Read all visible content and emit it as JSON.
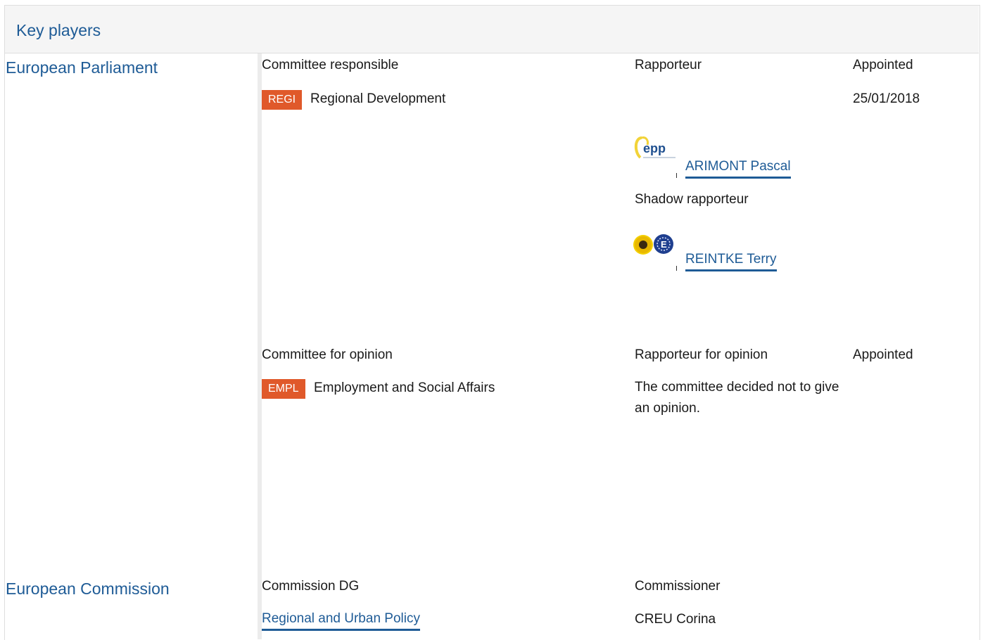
{
  "header": {
    "title": "Key players"
  },
  "parliament": {
    "title": "European Parliament",
    "committee_responsible_label": "Committee responsible",
    "rapporteur_label": "Rapporteur",
    "appointed_label": "Appointed",
    "responsible_committee": {
      "code": "REGI",
      "name": "Regional Development",
      "appointed": "25/01/2018"
    },
    "rapporteur": {
      "name": "ARIMONT Pascal",
      "group_logo": "epp-logo"
    },
    "shadow_rapporteur_label": "Shadow rapporteur",
    "shadow_rapporteur": {
      "name": "REINTKE Terry",
      "group_logo": "greens-efa-logo"
    },
    "committee_opinion_label": "Committee for opinion",
    "rapporteur_opinion_label": "Rapporteur for opinion",
    "appointed_opinion_label": "Appointed",
    "opinion_committee": {
      "code": "EMPL",
      "name": "Employment and Social Affairs",
      "note": "The committee decided not to give an opinion."
    }
  },
  "commission": {
    "title": "European Commission",
    "dg_label": "Commission DG",
    "commissioner_label": "Commissioner",
    "dg": "Regional and Urban Policy",
    "commissioner": "CREU Corina"
  },
  "colors": {
    "accent": "#1e5b96",
    "badge": "#e0592a",
    "panel": "#f5f5f5"
  }
}
